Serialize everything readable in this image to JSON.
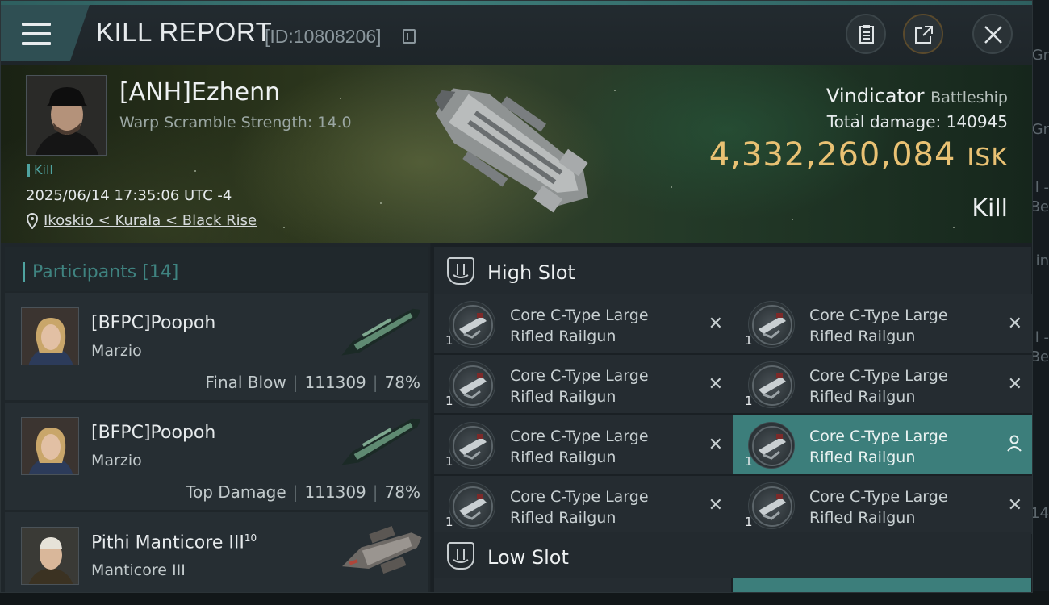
{
  "header": {
    "title": "KILL REPORT",
    "report_id": "[ID:10808206]",
    "clipboard_icon": "clipboard-icon",
    "share_icon": "share-icon",
    "close_icon": "close-icon"
  },
  "victim": {
    "pilot": "[ANH]Ezhenn",
    "warp_scramble": "Warp Scramble Strength: 14.0",
    "kill_tag": "Kill",
    "datetime": "2025/06/14 17:35:06 UTC -4",
    "location": "Ikoskio < Kurala < Black Rise",
    "ship_name": "Vindicator",
    "ship_class": "Battleship",
    "total_damage_label": "Total damage:",
    "total_damage": "140945",
    "isk_value": "4,332,260,084",
    "isk_unit": "ISK",
    "result": "Kill"
  },
  "participants": {
    "label": "Participants",
    "count": "[14]",
    "items": [
      {
        "name": "[BFPC]Poopoh",
        "ship": "Marzio",
        "role": "Final Blow",
        "damage": "111309",
        "percent": "78%"
      },
      {
        "name": "[BFPC]Poopoh",
        "ship": "Marzio",
        "role": "Top Damage",
        "damage": "111309",
        "percent": "78%"
      },
      {
        "name": "Pithi Manticore III",
        "name_sup": "10",
        "ship": "Manticore III"
      }
    ]
  },
  "slots": {
    "high": {
      "label": "High Slot",
      "modules": [
        {
          "line1": "Core C-Type Large",
          "line2": "Rifled Railgun",
          "qty": "1"
        },
        {
          "line1": "Core C-Type Large",
          "line2": "Rifled Railgun",
          "qty": "1"
        },
        {
          "line1": "Core C-Type Large",
          "line2": "Rifled Railgun",
          "qty": "1"
        },
        {
          "line1": "Core C-Type Large",
          "line2": "Rifled Railgun",
          "qty": "1"
        },
        {
          "line1": "Core C-Type Large",
          "line2": "Rifled Railgun",
          "qty": "1"
        },
        {
          "line1": "Core C-Type Large",
          "line2": "Rifled Railgun",
          "qty": "1"
        },
        {
          "line1": "Core C-Type Large",
          "line2": "Rifled Railgun",
          "qty": "1"
        },
        {
          "line1": "Core C-Type Large",
          "line2": "Rifled Railgun",
          "qty": "1"
        }
      ]
    },
    "low": {
      "label": "Low Slot"
    }
  },
  "colors": {
    "accent_teal": "#4fa3a0",
    "isk_gold": "#e9c173",
    "selected_row": "#3c7e7b"
  }
}
